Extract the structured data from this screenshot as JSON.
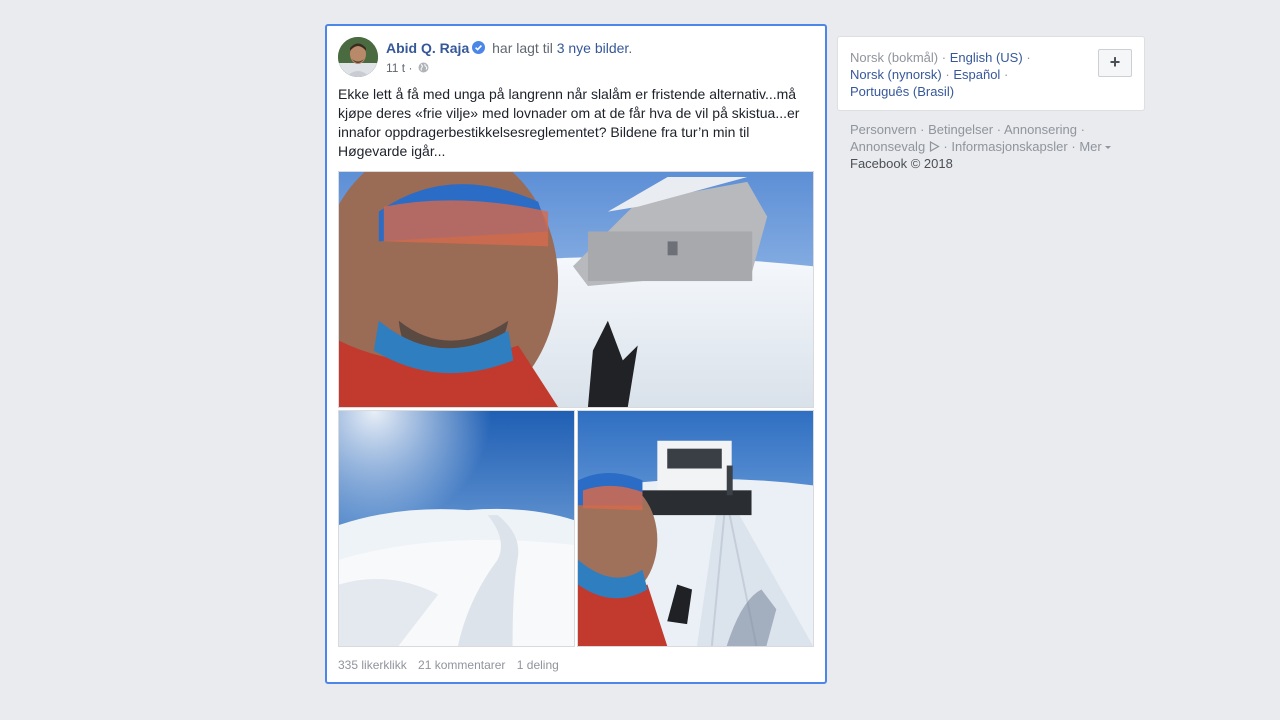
{
  "post": {
    "author": "Abid Q. Raja",
    "action_prefix": "har lagt til",
    "action_link": "3 nye bilder",
    "action_suffix": ".",
    "time": "11 t",
    "separator": "·",
    "text": "Ekke lett å få med unga på langrenn når slalåm er fristende alternativ...må kjøpe deres «frie vilje» med lovnader om at de får hva de vil på skistua...er innafor oppdragerbestikkelsesreglementet? Bildene fra tur’n min til Høgevarde igår...",
    "stats": {
      "likes": "335 likerklikk",
      "comments": "21 kommentarer",
      "shares": "1 deling"
    },
    "icons": {
      "verified": "verified-badge-icon",
      "audience": "globe-icon"
    },
    "accent_color": "#4b86e8",
    "link_color": "#365899"
  },
  "languages": {
    "current": "Norsk (bokmål)",
    "others": [
      "English (US)",
      "Norsk (nynorsk)",
      "Español",
      "Português (Brasil)"
    ],
    "dot": "·",
    "add_button": "+"
  },
  "footer": {
    "links": [
      "Personvern",
      "Betingelser",
      "Annonsering",
      "Annonsevalg",
      "Informasjonskapsler",
      "Mer"
    ],
    "copyright": "Facebook © 2018",
    "dot": "·"
  }
}
